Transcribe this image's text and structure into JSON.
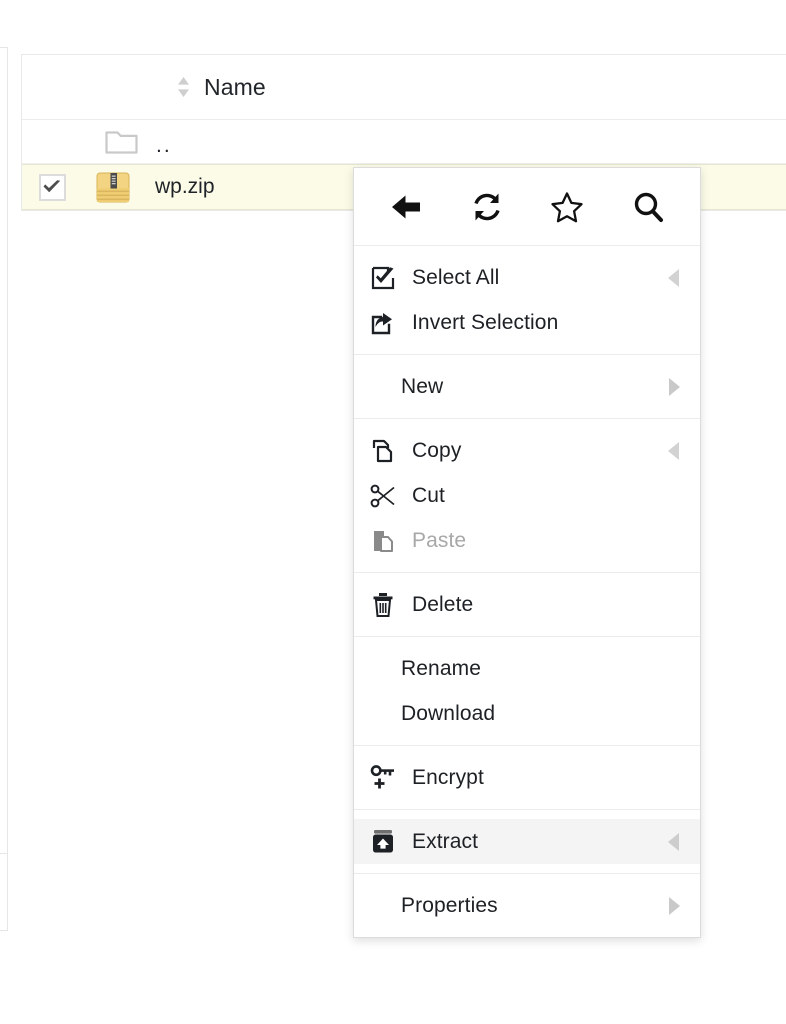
{
  "file_table": {
    "columns": [
      {
        "label": "Name",
        "sort_icon": "sort-updown-icon"
      }
    ],
    "rows": [
      {
        "kind": "parent",
        "icon": "folder-icon",
        "name": "..",
        "selected": false,
        "checkbox": false
      },
      {
        "kind": "file",
        "icon": "zip-archive-icon",
        "name": "wp.zip",
        "selected": true,
        "checkbox": true,
        "checked": true
      }
    ]
  },
  "context_menu": {
    "toolbar": [
      {
        "name": "back-icon",
        "label": "Back"
      },
      {
        "name": "refresh-icon",
        "label": "Refresh"
      },
      {
        "name": "star-icon",
        "label": "Bookmark"
      },
      {
        "name": "search-icon",
        "label": "Search"
      }
    ],
    "groups": [
      {
        "items": [
          {
            "label": "Select All",
            "icon": "checkbox-checked-icon",
            "arrow": "left",
            "disabled": false,
            "hovered": false
          },
          {
            "label": "Invert Selection",
            "icon": "invert-selection-icon",
            "arrow": "none",
            "disabled": false,
            "hovered": false
          }
        ]
      },
      {
        "items": [
          {
            "label": "New",
            "icon": "none",
            "arrow": "right",
            "disabled": false,
            "hovered": false
          }
        ]
      },
      {
        "items": [
          {
            "label": "Copy",
            "icon": "copy-icon",
            "arrow": "left",
            "disabled": false,
            "hovered": false
          },
          {
            "label": "Cut",
            "icon": "scissors-icon",
            "arrow": "none",
            "disabled": false,
            "hovered": false
          },
          {
            "label": "Paste",
            "icon": "paste-icon",
            "arrow": "none",
            "disabled": true,
            "hovered": false
          }
        ]
      },
      {
        "items": [
          {
            "label": "Delete",
            "icon": "trash-icon",
            "arrow": "none",
            "disabled": false,
            "hovered": false
          }
        ]
      },
      {
        "items": [
          {
            "label": "Rename",
            "icon": "none",
            "arrow": "none",
            "disabled": false,
            "hovered": false
          },
          {
            "label": "Download",
            "icon": "none",
            "arrow": "none",
            "disabled": false,
            "hovered": false
          }
        ]
      },
      {
        "items": [
          {
            "label": "Encrypt",
            "icon": "key-plus-icon",
            "arrow": "none",
            "disabled": false,
            "hovered": false
          }
        ]
      },
      {
        "items": [
          {
            "label": "Extract",
            "icon": "extract-icon",
            "arrow": "left",
            "disabled": false,
            "hovered": true
          }
        ]
      },
      {
        "items": [
          {
            "label": "Properties",
            "icon": "none",
            "arrow": "right",
            "disabled": false,
            "hovered": false
          }
        ]
      }
    ]
  },
  "colors": {
    "selected_row": "#fbfbe8",
    "hover_row": "#f4f4f4",
    "text": "#1d2024",
    "disabled_text": "#a8a8a8",
    "border": "#dcdcdc",
    "zip_icon": "#f0cd7a"
  }
}
